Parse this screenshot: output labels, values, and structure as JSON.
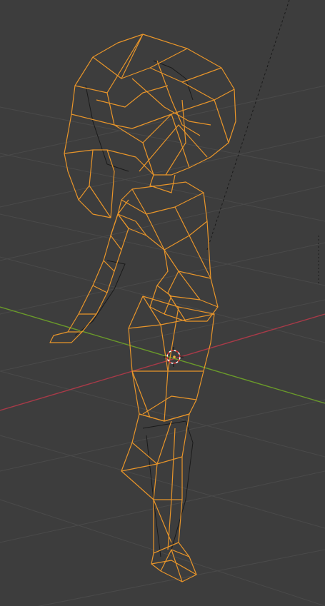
{
  "viewport": {
    "mode": "wireframe",
    "background_color": "#3d3d3d",
    "grid_color": "#4a4a4a",
    "x_axis_color": "#a83a48",
    "y_axis_color": "#6a9a2a",
    "selection_color": "#e8952a",
    "unselected_wire_color": "#1a1a1a",
    "camera_line_color": "#1a1a1a",
    "cursor_icon": "3d-cursor-icon",
    "selected_object": "character-mesh"
  }
}
